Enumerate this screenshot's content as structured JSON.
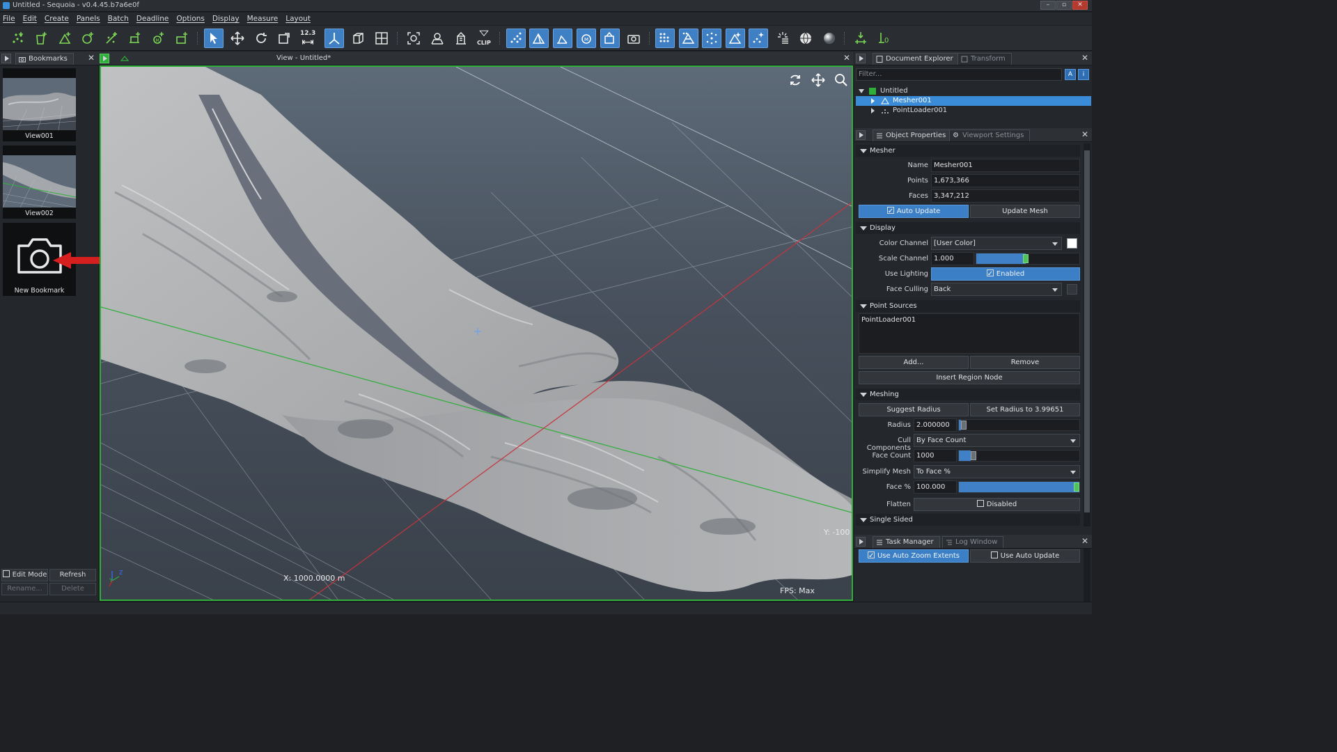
{
  "window": {
    "title": "Untitled - Sequoia - v0.4.45.b7a6e0f",
    "buttons": [
      "–",
      "▫",
      "✕"
    ]
  },
  "menu": [
    "File",
    "Edit",
    "Create",
    "Panels",
    "Batch",
    "Deadline",
    "Options",
    "Display",
    "Measure",
    "Layout"
  ],
  "toolbar": {
    "measure_label": "12.3",
    "clip_label": "CLIP"
  },
  "bookmarks_panel": {
    "tab_label": "Bookmarks",
    "items": [
      {
        "label": "View001"
      },
      {
        "label": "View002"
      },
      {
        "label": "New Bookmark"
      }
    ],
    "edit_mode_label": "Edit Mode",
    "refresh_label": "Refresh",
    "rename_label": "Rename...",
    "delete_label": "Delete"
  },
  "viewport": {
    "title": "View - Untitled*",
    "x_readout": "X:  1000.0000  m",
    "y_readout": "Y: -100",
    "fps_readout": "FPS:  Max",
    "axis_y": "Y",
    "axis_z": "Z"
  },
  "document_explorer": {
    "tab_label": "Document Explorer",
    "transform_tab_label": "Transform",
    "filter_placeholder": "Filter...",
    "tree": [
      {
        "label": "Untitled",
        "color": "#2fae3a"
      },
      {
        "label": "Mesher001",
        "selected": true
      },
      {
        "label": "PointLoader001"
      }
    ]
  },
  "object_properties": {
    "tab_label": "Object Properties",
    "viewport_settings_tab_label": "Viewport Settings",
    "mesher_section": "Mesher",
    "name_label": "Name",
    "name_value": "Mesher001",
    "points_label": "Points",
    "points_value": "1,673,366",
    "faces_label": "Faces",
    "faces_value": "3,347,212",
    "auto_update_label": "Auto Update",
    "update_mesh_label": "Update Mesh",
    "display_section": "Display",
    "color_channel_label": "Color Channel",
    "color_channel_value": "[User Color]",
    "scale_channel_label": "Scale Channel",
    "scale_channel_value": "1.000",
    "scale_channel_fraction": 0.48,
    "use_lighting_label": "Use Lighting",
    "use_lighting_value": "Enabled",
    "face_culling_label": "Face Culling",
    "face_culling_value": "Back",
    "point_sources_section": "Point Sources",
    "point_sources": [
      "PointLoader001"
    ],
    "add_label": "Add...",
    "remove_label": "Remove",
    "insert_region_label": "Insert Region Node",
    "meshing_section": "Meshing",
    "suggest_radius_label": "Suggest Radius",
    "set_radius_label": "Set Radius to 3.99651",
    "radius_label": "Radius",
    "radius_value": "2.000000",
    "radius_fraction": 0.02,
    "cull_components_label": "Cull Components",
    "cull_components_value": "By Face Count",
    "face_count_label": "Face Count",
    "face_count_value": "1000",
    "face_count_fraction": 0.1,
    "simplify_mesh_label": "Simplify Mesh",
    "simplify_mesh_value": "To Face %",
    "face_pct_label": "Face %",
    "face_pct_value": "100.000",
    "face_pct_fraction": 1.0,
    "flatten_label": "Flatten",
    "flatten_value": "Disabled",
    "single_sided_section": "Single Sided"
  },
  "task_manager": {
    "tab_label": "Task Manager",
    "log_tab_label": "Log Window",
    "auto_zoom_label": "Use Auto Zoom Extents",
    "auto_update_label": "Use Auto Update"
  },
  "colors": {
    "accent": "#3a8cd8",
    "viewport_border": "#2fae3a",
    "arrow": "#d61f1f"
  }
}
